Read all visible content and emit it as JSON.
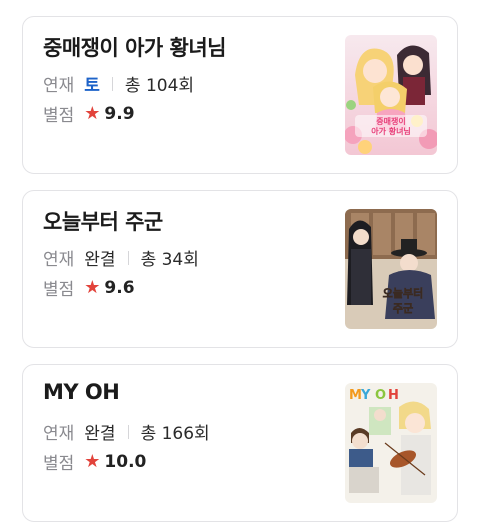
{
  "labels": {
    "serial": "연재",
    "rating": "별점",
    "star": "★"
  },
  "items": [
    {
      "title": "중매쟁이 아가 황녀님",
      "schedule": "토",
      "episodes": "총 104회",
      "rating": "9.9",
      "cover_text": "중매쟁이 아가 황녀님"
    },
    {
      "title": "오늘부터 주군",
      "schedule": "완결",
      "episodes": "총 34회",
      "rating": "9.6",
      "cover_text": "오늘부터 주군"
    },
    {
      "title": "MY OH",
      "schedule": "완결",
      "episodes": "총 166회",
      "rating": "10.0",
      "cover_text": "MY OH"
    }
  ],
  "colors": {
    "day_accent": "#1e63c9",
    "star": "#e2433b",
    "muted_label": "#8a8a8f"
  }
}
